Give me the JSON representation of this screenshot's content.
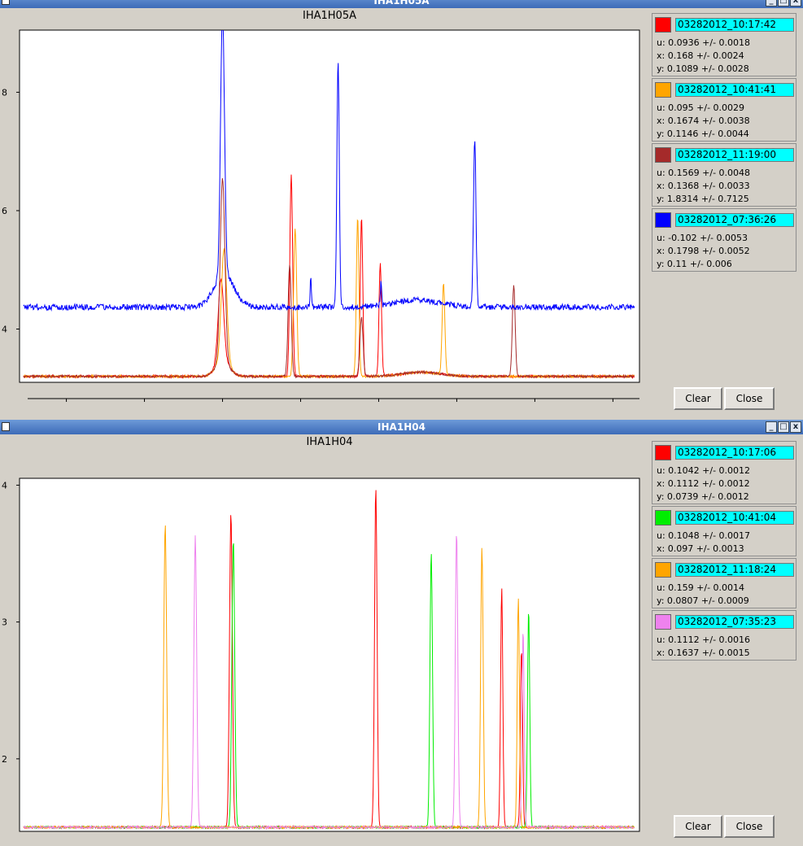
{
  "windows": [
    {
      "title": "IHA1H05A",
      "show_buttons": false,
      "chart_data": {
        "type": "line",
        "title": "IHA1H05A",
        "xlabel": "",
        "ylabel": "",
        "xlim": [
          4,
          83.4
        ],
        "ylim": [
          3.1,
          9.05
        ],
        "xticks": [
          20,
          40,
          60,
          80
        ],
        "yticks": [
          4,
          6,
          8
        ],
        "baseline_y_blue": 4.37,
        "baseline_y_other": 3.2,
        "series": [
          {
            "name": "03282012_10:17:42",
            "color": "#ff0000",
            "base": 3.2,
            "noise": 0.02,
            "peaks": [
              [
                29.8,
                1.4,
                0.35
              ],
              [
                38.8,
                3.4,
                0.18
              ],
              [
                47.8,
                2.7,
                0.16
              ],
              [
                50.2,
                1.9,
                0.16
              ]
            ]
          },
          {
            "name": "03282012_10:41:41",
            "color": "#ffa500",
            "base": 3.2,
            "noise": 0.02,
            "peaks": [
              [
                30.2,
                1.9,
                0.35
              ],
              [
                39.3,
                2.5,
                0.2
              ],
              [
                47.3,
                2.7,
                0.16
              ],
              [
                58.3,
                1.55,
                0.17
              ]
            ]
          },
          {
            "name": "03282012_11:19:00",
            "color": "#a52a2a",
            "base": 3.2,
            "noise": 0.02,
            "peaks": [
              [
                30.0,
                3.1,
                0.3
              ],
              [
                38.6,
                1.9,
                0.2
              ],
              [
                47.8,
                1.0,
                0.2
              ],
              [
                67.3,
                1.55,
                0.18
              ]
            ]
          },
          {
            "name": "03282012_07:36:26",
            "color": "#0000ff",
            "base": 4.37,
            "noise": 0.05,
            "peaks": [
              [
                30.0,
                4.45,
                0.25
              ],
              [
                44.8,
                4.2,
                0.15
              ],
              [
                62.3,
                2.85,
                0.16
              ],
              [
                41.3,
                0.5,
                0.08
              ],
              [
                50.3,
                0.4,
                0.08
              ]
            ]
          }
        ]
      },
      "legend": [
        {
          "label": "03282012_10:17:42",
          "color": "#ff0000",
          "stats": [
            "u: 0.0936 +/- 0.0018",
            "x: 0.168 +/- 0.0024",
            "y: 0.1089 +/- 0.0028"
          ]
        },
        {
          "label": "03282012_10:41:41",
          "color": "#ffa500",
          "stats": [
            "u: 0.095 +/- 0.0029",
            "x: 0.1674 +/- 0.0038",
            "y: 0.1146 +/- 0.0044"
          ]
        },
        {
          "label": "03282012_11:19:00",
          "color": "#a52a2a",
          "stats": [
            "u: 0.1569 +/- 0.0048",
            "x: 0.1368 +/- 0.0033",
            "y: 1.8314 +/- 0.7125"
          ]
        },
        {
          "label": "03282012_07:36:26",
          "color": "#0000ff",
          "stats": [
            "u: -0.102 +/- 0.0053",
            "x: 0.1798 +/- 0.0052",
            "y: 0.11 +/- 0.006"
          ]
        }
      ],
      "buttons": {
        "clear": "Clear",
        "close": "Close"
      }
    },
    {
      "title": "IHA1H04",
      "show_buttons": true,
      "chart_data": {
        "type": "line",
        "title": "IHA1H04",
        "xlabel": "",
        "ylabel": "",
        "xlim": [
          4,
          82.3
        ],
        "ylim": [
          1.47,
          4.05
        ],
        "xticks": [
          20,
          40,
          60,
          80
        ],
        "yticks": [
          2,
          3,
          4
        ],
        "series": [
          {
            "name": "03282012_10:17:06",
            "color": "#ff0000",
            "base": 1.5,
            "noise": 0.008,
            "peaks": [
              [
                30.7,
                2.3,
                0.18
              ],
              [
                49.0,
                2.48,
                0.16
              ],
              [
                64.9,
                1.75,
                0.14
              ],
              [
                67.4,
                1.3,
                0.14
              ]
            ]
          },
          {
            "name": "03282012_10:41:04",
            "color": "#00ee00",
            "base": 1.5,
            "noise": 0.008,
            "peaks": [
              [
                31.0,
                2.1,
                0.18
              ],
              [
                56.0,
                2.02,
                0.16
              ],
              [
                68.3,
                1.6,
                0.14
              ]
            ]
          },
          {
            "name": "03282012_11:18:24",
            "color": "#ffa500",
            "base": 1.5,
            "noise": 0.008,
            "peaks": [
              [
                22.4,
                2.22,
                0.18
              ],
              [
                62.4,
                2.05,
                0.16
              ],
              [
                67.0,
                1.68,
                0.14
              ]
            ]
          },
          {
            "name": "03282012_07:35:23",
            "color": "#ee82ee",
            "base": 1.5,
            "noise": 0.008,
            "peaks": [
              [
                26.2,
                2.13,
                0.18
              ],
              [
                59.2,
                2.16,
                0.16
              ],
              [
                67.6,
                1.45,
                0.14
              ]
            ]
          }
        ]
      },
      "legend": [
        {
          "label": "03282012_10:17:06",
          "color": "#ff0000",
          "stats": [
            "u: 0.1042 +/- 0.0012",
            "x: 0.1112 +/- 0.0012",
            "y: 0.0739 +/- 0.0012"
          ]
        },
        {
          "label": "03282012_10:41:04",
          "color": "#00ee00",
          "stats": [
            "u: 0.1048 +/- 0.0017",
            "x: 0.097 +/- 0.0013"
          ]
        },
        {
          "label": "03282012_11:18:24",
          "color": "#ffa500",
          "stats": [
            "u: 0.159 +/- 0.0014",
            "y: 0.0807 +/- 0.0009"
          ]
        },
        {
          "label": "03282012_07:35:23",
          "color": "#ee82ee",
          "stats": [
            "u: 0.1112 +/- 0.0016",
            "x: 0.1637 +/- 0.0015"
          ]
        }
      ],
      "buttons": {
        "clear": "Clear",
        "close": "Close"
      }
    }
  ],
  "window_controls": {
    "minimize": "_",
    "maximize": "□",
    "close": "x"
  }
}
